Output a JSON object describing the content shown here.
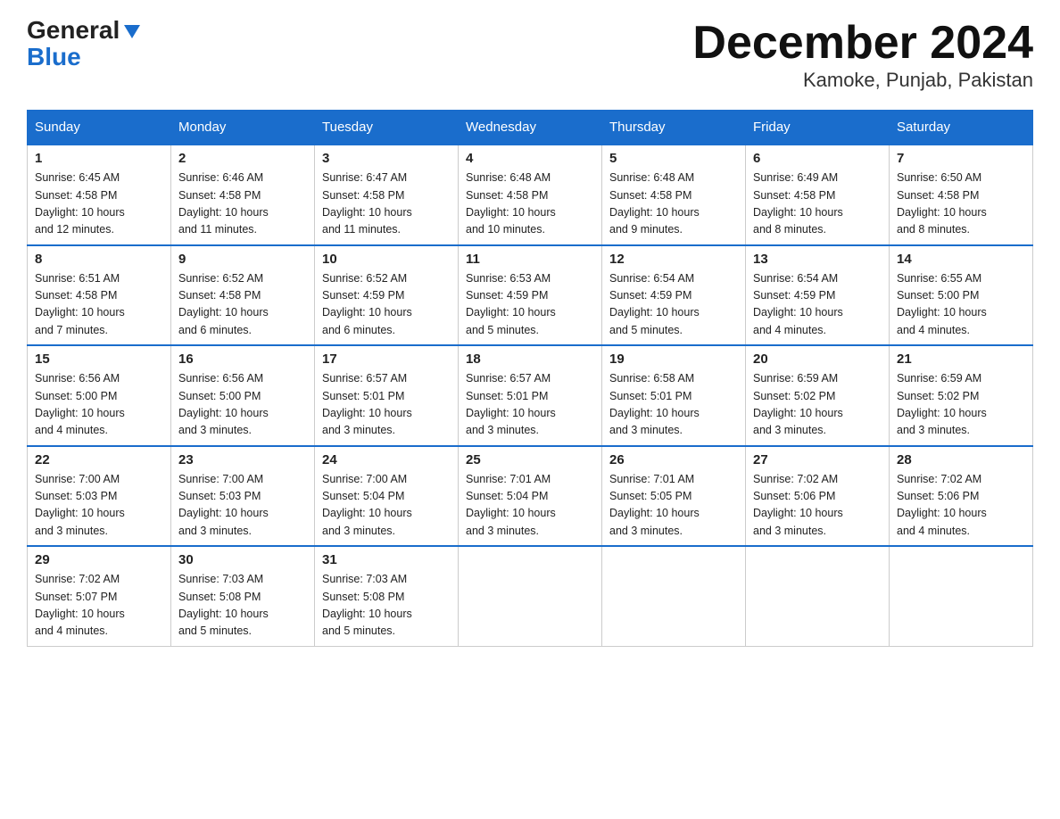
{
  "logo": {
    "general": "General",
    "blue": "Blue",
    "triangle": "▼"
  },
  "title": "December 2024",
  "location": "Kamoke, Punjab, Pakistan",
  "days_of_week": [
    "Sunday",
    "Monday",
    "Tuesday",
    "Wednesday",
    "Thursday",
    "Friday",
    "Saturday"
  ],
  "weeks": [
    [
      {
        "day": "1",
        "sunrise": "6:45 AM",
        "sunset": "4:58 PM",
        "daylight": "10 hours and 12 minutes."
      },
      {
        "day": "2",
        "sunrise": "6:46 AM",
        "sunset": "4:58 PM",
        "daylight": "10 hours and 11 minutes."
      },
      {
        "day": "3",
        "sunrise": "6:47 AM",
        "sunset": "4:58 PM",
        "daylight": "10 hours and 11 minutes."
      },
      {
        "day": "4",
        "sunrise": "6:48 AM",
        "sunset": "4:58 PM",
        "daylight": "10 hours and 10 minutes."
      },
      {
        "day": "5",
        "sunrise": "6:48 AM",
        "sunset": "4:58 PM",
        "daylight": "10 hours and 9 minutes."
      },
      {
        "day": "6",
        "sunrise": "6:49 AM",
        "sunset": "4:58 PM",
        "daylight": "10 hours and 8 minutes."
      },
      {
        "day": "7",
        "sunrise": "6:50 AM",
        "sunset": "4:58 PM",
        "daylight": "10 hours and 8 minutes."
      }
    ],
    [
      {
        "day": "8",
        "sunrise": "6:51 AM",
        "sunset": "4:58 PM",
        "daylight": "10 hours and 7 minutes."
      },
      {
        "day": "9",
        "sunrise": "6:52 AM",
        "sunset": "4:58 PM",
        "daylight": "10 hours and 6 minutes."
      },
      {
        "day": "10",
        "sunrise": "6:52 AM",
        "sunset": "4:59 PM",
        "daylight": "10 hours and 6 minutes."
      },
      {
        "day": "11",
        "sunrise": "6:53 AM",
        "sunset": "4:59 PM",
        "daylight": "10 hours and 5 minutes."
      },
      {
        "day": "12",
        "sunrise": "6:54 AM",
        "sunset": "4:59 PM",
        "daylight": "10 hours and 5 minutes."
      },
      {
        "day": "13",
        "sunrise": "6:54 AM",
        "sunset": "4:59 PM",
        "daylight": "10 hours and 4 minutes."
      },
      {
        "day": "14",
        "sunrise": "6:55 AM",
        "sunset": "5:00 PM",
        "daylight": "10 hours and 4 minutes."
      }
    ],
    [
      {
        "day": "15",
        "sunrise": "6:56 AM",
        "sunset": "5:00 PM",
        "daylight": "10 hours and 4 minutes."
      },
      {
        "day": "16",
        "sunrise": "6:56 AM",
        "sunset": "5:00 PM",
        "daylight": "10 hours and 3 minutes."
      },
      {
        "day": "17",
        "sunrise": "6:57 AM",
        "sunset": "5:01 PM",
        "daylight": "10 hours and 3 minutes."
      },
      {
        "day": "18",
        "sunrise": "6:57 AM",
        "sunset": "5:01 PM",
        "daylight": "10 hours and 3 minutes."
      },
      {
        "day": "19",
        "sunrise": "6:58 AM",
        "sunset": "5:01 PM",
        "daylight": "10 hours and 3 minutes."
      },
      {
        "day": "20",
        "sunrise": "6:59 AM",
        "sunset": "5:02 PM",
        "daylight": "10 hours and 3 minutes."
      },
      {
        "day": "21",
        "sunrise": "6:59 AM",
        "sunset": "5:02 PM",
        "daylight": "10 hours and 3 minutes."
      }
    ],
    [
      {
        "day": "22",
        "sunrise": "7:00 AM",
        "sunset": "5:03 PM",
        "daylight": "10 hours and 3 minutes."
      },
      {
        "day": "23",
        "sunrise": "7:00 AM",
        "sunset": "5:03 PM",
        "daylight": "10 hours and 3 minutes."
      },
      {
        "day": "24",
        "sunrise": "7:00 AM",
        "sunset": "5:04 PM",
        "daylight": "10 hours and 3 minutes."
      },
      {
        "day": "25",
        "sunrise": "7:01 AM",
        "sunset": "5:04 PM",
        "daylight": "10 hours and 3 minutes."
      },
      {
        "day": "26",
        "sunrise": "7:01 AM",
        "sunset": "5:05 PM",
        "daylight": "10 hours and 3 minutes."
      },
      {
        "day": "27",
        "sunrise": "7:02 AM",
        "sunset": "5:06 PM",
        "daylight": "10 hours and 3 minutes."
      },
      {
        "day": "28",
        "sunrise": "7:02 AM",
        "sunset": "5:06 PM",
        "daylight": "10 hours and 4 minutes."
      }
    ],
    [
      {
        "day": "29",
        "sunrise": "7:02 AM",
        "sunset": "5:07 PM",
        "daylight": "10 hours and 4 minutes."
      },
      {
        "day": "30",
        "sunrise": "7:03 AM",
        "sunset": "5:08 PM",
        "daylight": "10 hours and 5 minutes."
      },
      {
        "day": "31",
        "sunrise": "7:03 AM",
        "sunset": "5:08 PM",
        "daylight": "10 hours and 5 minutes."
      },
      null,
      null,
      null,
      null
    ]
  ],
  "labels": {
    "sunrise": "Sunrise:",
    "sunset": "Sunset:",
    "daylight": "Daylight:"
  }
}
